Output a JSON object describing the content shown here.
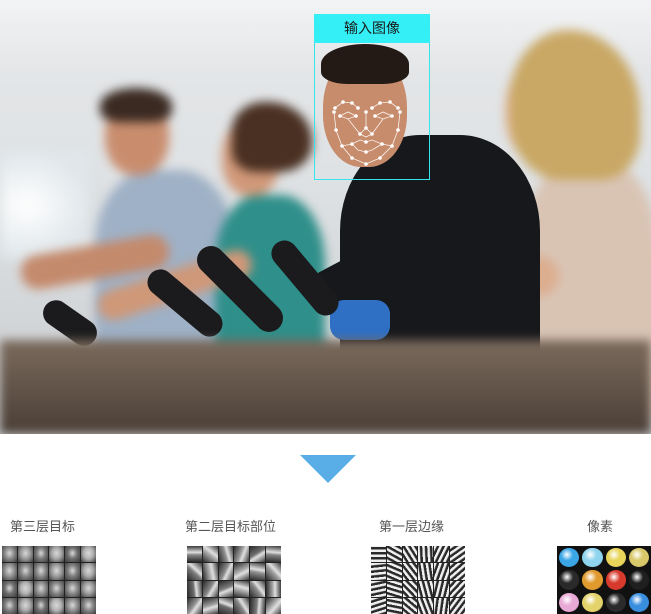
{
  "detection": {
    "label": "输入图像"
  },
  "layers": [
    {
      "title": "第三层目标",
      "thumb_icon": "face-features-grid"
    },
    {
      "title": "第二层目标部位",
      "thumb_icon": "face-parts-grid"
    },
    {
      "title": "第一层边缘",
      "thumb_icon": "edge-filters-grid"
    },
    {
      "title": "像素",
      "thumb_icon": "pixel-color-grid"
    }
  ],
  "colors": {
    "detection_box": "#35e5ee",
    "label_bg": "#34f0f6",
    "arrow": "#5aaee8",
    "caption_text": "#555555"
  }
}
